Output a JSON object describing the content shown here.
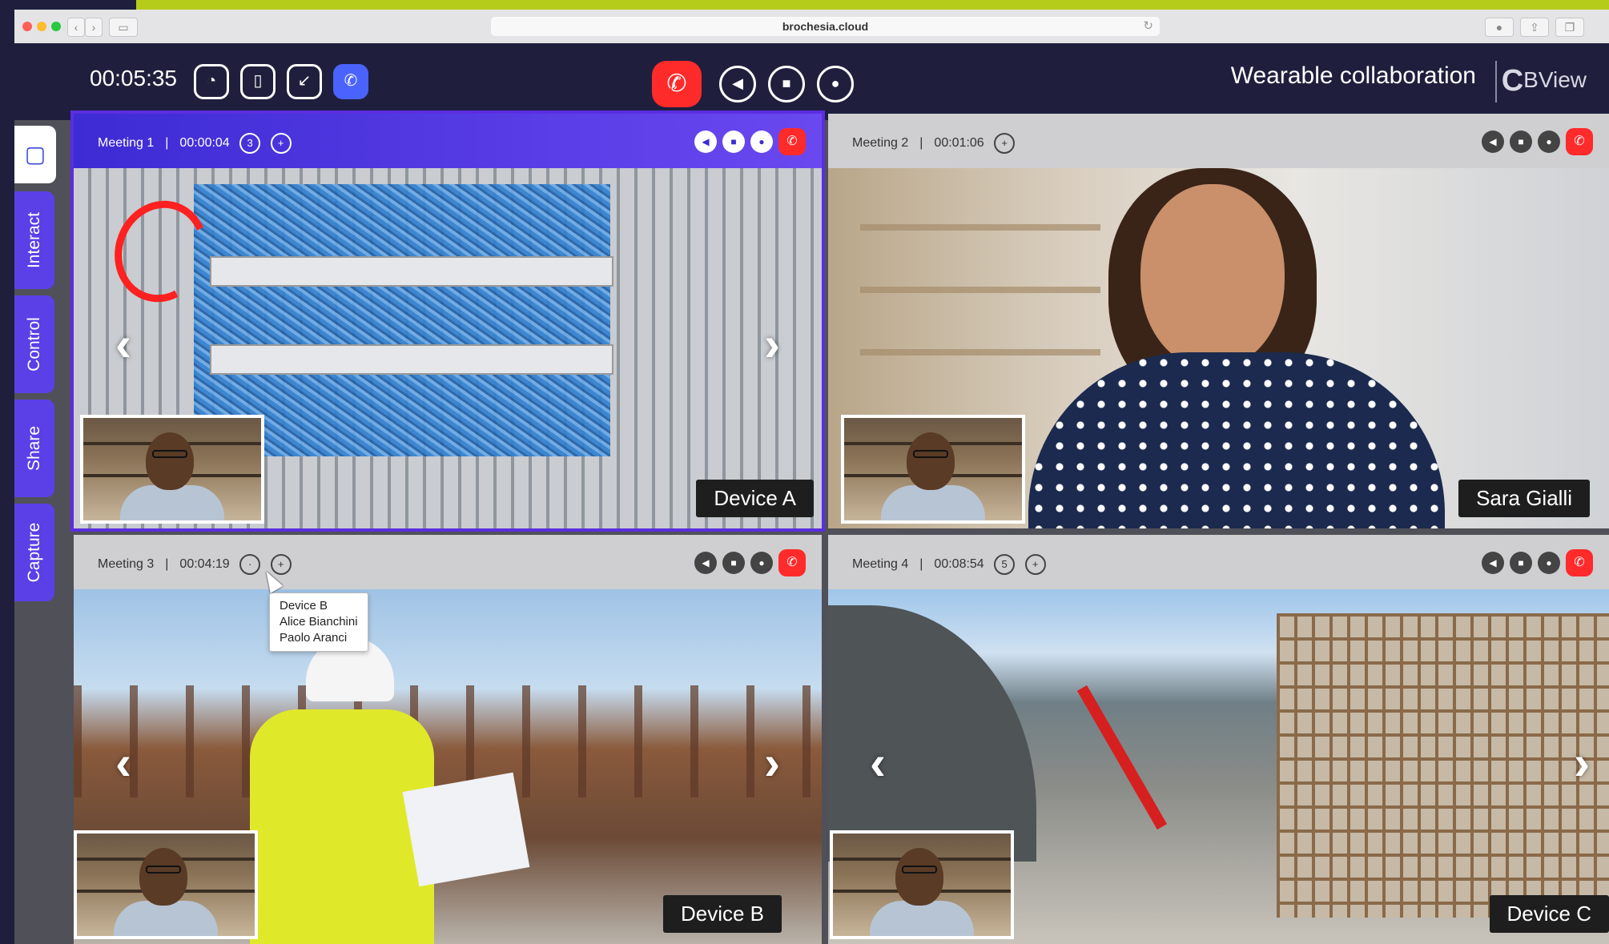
{
  "browser": {
    "url": "brochesia.cloud"
  },
  "toolbar": {
    "timer": "00:05:35",
    "app_title": "Wearable collaboration",
    "logo_text": "BView",
    "accent": "#b5cc1a",
    "hangup_color": "#ff2a2a",
    "active_color": "#5a40e6"
  },
  "sidebar": {
    "tabs": [
      {
        "label": "Interact"
      },
      {
        "label": "Control"
      },
      {
        "label": "Share"
      },
      {
        "label": "Capture"
      }
    ]
  },
  "meetings": [
    {
      "title": "Meeting 1",
      "time": "00:00:04",
      "participants": "3",
      "device": "Device A"
    },
    {
      "title": "Meeting 2",
      "time": "00:01:06",
      "participants": "",
      "device": "Sara Gialli"
    },
    {
      "title": "Meeting 3",
      "time": "00:04:19",
      "participants": "",
      "device": "Device B",
      "tooltip": [
        "Device B",
        "Alice Bianchini",
        "Paolo Aranci"
      ]
    },
    {
      "title": "Meeting 4",
      "time": "00:08:54",
      "participants": "5",
      "device": "Device C"
    }
  ]
}
